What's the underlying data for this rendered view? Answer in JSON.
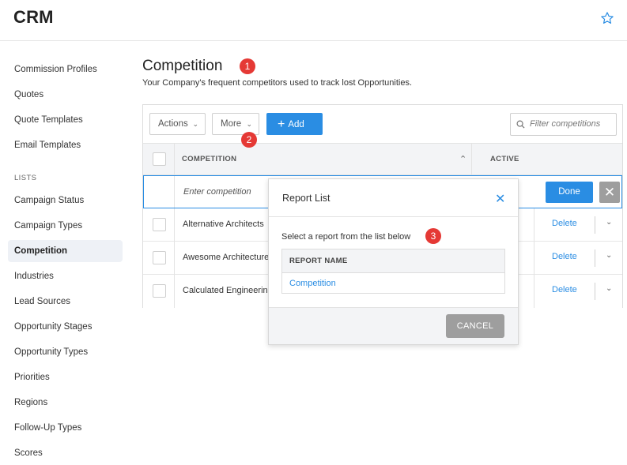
{
  "app": {
    "title": "CRM"
  },
  "sidebar": {
    "items_top": [
      "Commission Profiles",
      "Quotes",
      "Quote Templates",
      "Email Templates"
    ],
    "section_label": "LISTS",
    "items_lists": [
      "Campaign Status",
      "Campaign Types",
      "Competition",
      "Industries",
      "Lead Sources",
      "Opportunity Stages",
      "Opportunity Types",
      "Priorities",
      "Regions",
      "Follow-Up Types",
      "Scores"
    ],
    "active": "Competition"
  },
  "page": {
    "title": "Competition",
    "subtitle": "Your Company's frequent competitors used to track lost Opportunities."
  },
  "badges": [
    "1",
    "2",
    "3"
  ],
  "toolbar": {
    "actions_label": "Actions",
    "more_label": "More",
    "add_label": "Add",
    "filter_placeholder": "Filter competitions"
  },
  "table": {
    "columns": [
      "COMPETITION",
      "ACTIVE"
    ],
    "edit_placeholder": "Enter competition",
    "done_label": "Done",
    "rows": [
      {
        "name": "Alternative Architects",
        "action": "Delete"
      },
      {
        "name": "Awesome Architecture",
        "action": "Delete"
      },
      {
        "name": "Calculated Engineering",
        "action": "Delete"
      }
    ]
  },
  "modal": {
    "title": "Report List",
    "prompt": "Select a report from the list below",
    "column": "REPORT NAME",
    "reports": [
      "Competition"
    ],
    "cancel_label": "CANCEL"
  },
  "colors": {
    "accent": "#2a8de3",
    "badge": "#e53935",
    "gray_button": "#9e9e9e"
  }
}
